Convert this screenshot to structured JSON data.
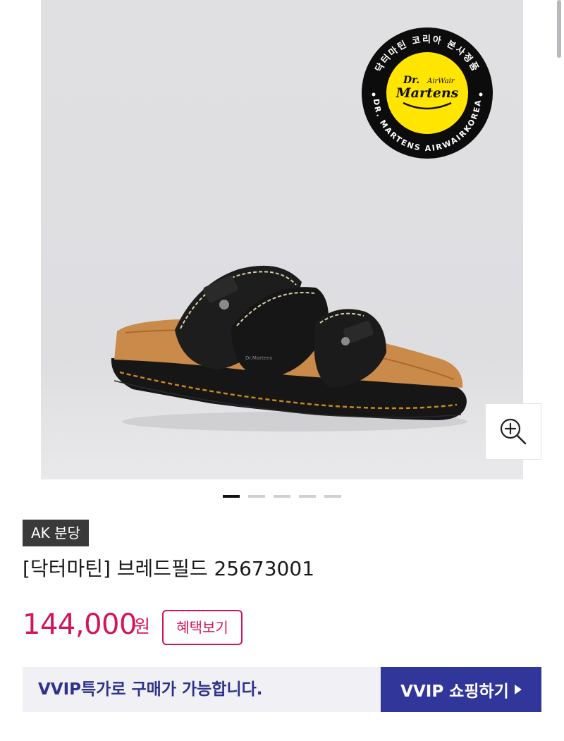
{
  "gallery": {
    "badge": {
      "ring_text_top": "닥터마틴 코리아 본사정품",
      "ring_text_bottom": "DR. MARTENS AIRWAIRKOREA",
      "logo_line1": "Dr.",
      "logo_line2": "Martens",
      "logo_small": "AirWair"
    },
    "zoom_icon": "zoom-in-icon",
    "total_images": 5,
    "active_index": 0
  },
  "product": {
    "tag": "AK 분당",
    "title": "[닥터마틴] 브레드필드 25673001",
    "price": "144,000",
    "price_unit": "원",
    "benefit_button": "혜택보기"
  },
  "vvip": {
    "text": "VVIP특가로 구매가 가능합니다.",
    "button": "VVIP 쇼핑하기"
  },
  "colors": {
    "price": "#d4145a",
    "vvip_button": "#30369a",
    "vvip_text": "#2e3389",
    "badge_yellow": "#ffe500"
  }
}
